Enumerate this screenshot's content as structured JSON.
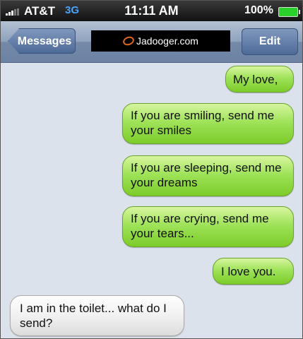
{
  "status_bar": {
    "carrier": "AT&T",
    "network": "3G",
    "time": "11:11 AM",
    "battery": "100%"
  },
  "nav_bar": {
    "back_label": "Messages",
    "title": "Jadooger.com",
    "edit_label": "Edit"
  },
  "messages": [
    {
      "from": "me",
      "text": "My love,"
    },
    {
      "from": "me",
      "text": "If you are smiling, send me your smiles"
    },
    {
      "from": "me",
      "text": "If you are sleeping, send me your dreams"
    },
    {
      "from": "me",
      "text": "If you are crying, send me your tears..."
    },
    {
      "from": "me",
      "text": "I love you."
    },
    {
      "from": "them",
      "text": "I am in the toilet... what do I send?"
    }
  ],
  "colors": {
    "sent_bubble": "#9fe35a",
    "received_bubble": "#f1f1f1",
    "background": "#dbe2ec",
    "nav_bar": "#8ea2bd"
  }
}
